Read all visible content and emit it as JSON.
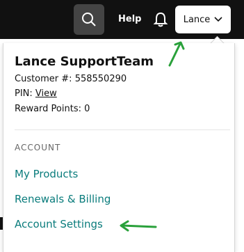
{
  "header": {
    "help_label": "Help",
    "user_button_label": "Lance",
    "icons": [
      "search-icon",
      "bell-icon",
      "chevron-down-icon"
    ],
    "colors": {
      "bar": "#111111",
      "search_bg": "#444444"
    }
  },
  "menu": {
    "account_name": "Lance SupportTeam",
    "customer_label": "Customer #:",
    "customer_number": "558550290",
    "pin_label": "PIN:",
    "pin_link": "View",
    "reward_points_label": "Reward Points:",
    "reward_points_value": "0",
    "section_title": "ACCOUNT",
    "links": [
      {
        "label": "My Products"
      },
      {
        "label": "Renewals & Billing"
      },
      {
        "label": "Account Settings"
      }
    ],
    "link_color": "#0a7c7c"
  },
  "annotations": {
    "arrow_color": "#2aa13b"
  }
}
